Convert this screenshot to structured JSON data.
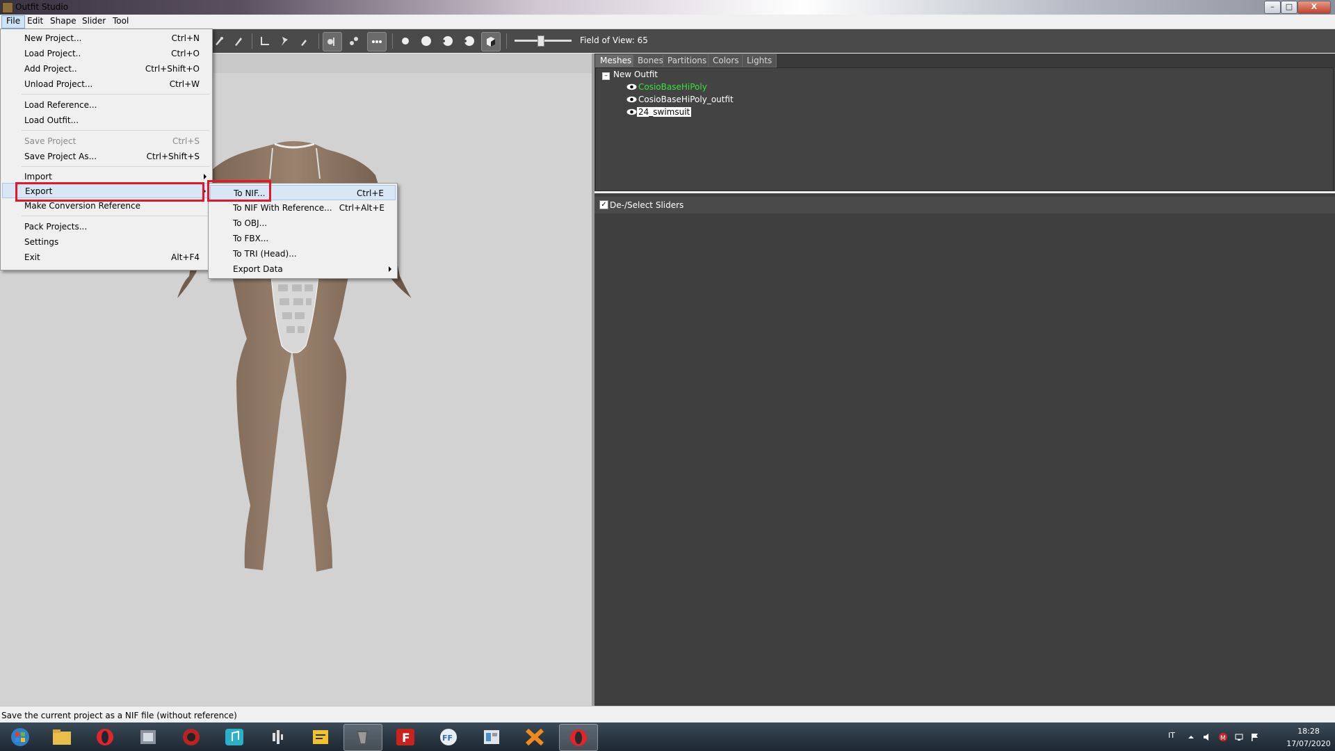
{
  "window": {
    "title": "Outfit Studio",
    "icon": "outfit-studio-icon"
  },
  "window_controls": {
    "minimize": "–",
    "maximize": "□",
    "close": "X"
  },
  "menubar": [
    "File",
    "Edit",
    "Shape",
    "Slider",
    "Tool"
  ],
  "file_menu": [
    {
      "label": "New Project...",
      "shortcut": "Ctrl+N"
    },
    {
      "label": "Load Project..",
      "shortcut": "Ctrl+O"
    },
    {
      "label": "Add Project..",
      "shortcut": "Ctrl+Shift+O"
    },
    {
      "label": "Unload Project...",
      "shortcut": "Ctrl+W"
    },
    {
      "label": "Load Reference...",
      "shortcut": ""
    },
    {
      "label": "Load Outfit...",
      "shortcut": ""
    },
    {
      "label": "Save Project",
      "shortcut": "Ctrl+S"
    },
    {
      "label": "Save Project As...",
      "shortcut": "Ctrl+Shift+S"
    },
    {
      "label": "Import",
      "shortcut": ""
    },
    {
      "label": "Export",
      "shortcut": ""
    },
    {
      "label": "Make Conversion Reference",
      "shortcut": ""
    },
    {
      "label": "Pack Projects...",
      "shortcut": ""
    },
    {
      "label": "Settings",
      "shortcut": ""
    },
    {
      "label": "Exit",
      "shortcut": "Alt+F4"
    }
  ],
  "export_submenu": [
    {
      "label": "To NIF...",
      "shortcut": "Ctrl+E"
    },
    {
      "label": "To NIF With Reference...",
      "shortcut": "Ctrl+Alt+E"
    },
    {
      "label": "To OBJ...",
      "shortcut": ""
    },
    {
      "label": "To FBX...",
      "shortcut": ""
    },
    {
      "label": "To TRI (Head)...",
      "shortcut": ""
    },
    {
      "label": "Export Data",
      "shortcut": ""
    }
  ],
  "toolbar": {
    "fov_label": "Field of View: 65",
    "fov_value": 65
  },
  "panel_tabs": [
    "Meshes",
    "Bones",
    "Partitions",
    "Colors",
    "Lights"
  ],
  "mesh_tree": {
    "root": "New Outfit",
    "meshes": [
      "CosioBaseHiPoly",
      "CosioBaseHiPoly_outfit",
      "24_swimsuit"
    ]
  },
  "sliders": {
    "label": "De-/Select Sliders",
    "checked": true
  },
  "status": "Save the current project as a NIF file (without reference)",
  "taskbar": {
    "apps": [
      "windows-start",
      "file-explorer",
      "opera",
      "media-app",
      "game-app",
      "music-app",
      "audio-editor",
      "notes-app",
      "outfit-studio",
      "filezilla",
      "ffdec",
      "document-app",
      "xsplit",
      "opera-gx"
    ],
    "lang": "IT",
    "time": "18:28",
    "date": "17/07/2020"
  }
}
